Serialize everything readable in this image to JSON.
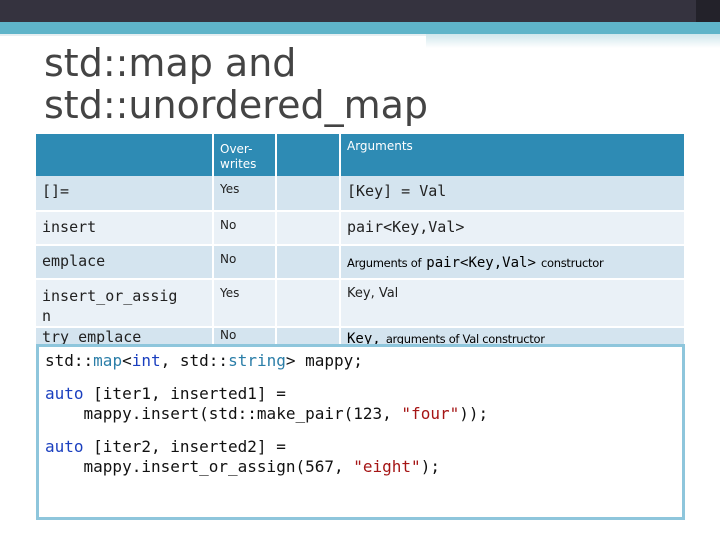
{
  "title": "std::map and std::unordered_map",
  "title_line1": "std::map and",
  "title_line2": "std::unordered_map",
  "table": {
    "headers": {
      "overwrites": "Over-\nwrites",
      "arguments": "Arguments"
    },
    "rows": [
      {
        "method": "[]=",
        "overwrites": "Yes",
        "args": "[Key] = Val"
      },
      {
        "method": "insert",
        "overwrites": "No",
        "args": "pair<Key,Val>"
      },
      {
        "method": "emplace",
        "overwrites": "No",
        "args_prefix": "Arguments of",
        "args_code": "pair<Key,Val>",
        "args_suffix": "constructor"
      },
      {
        "method": "insert_or_assign",
        "method_line1": "insert_or_assig",
        "method_line2": "n",
        "overwrites": "Yes",
        "args": "Key, Val"
      },
      {
        "method": "try_emplace",
        "overwrites": "No",
        "args_code": "Key,",
        "args_suffix": "arguments of Val constructor"
      }
    ]
  },
  "code": {
    "line1": {
      "ns1": "std::",
      "map": "map",
      "lt": "<",
      "int": "int",
      "mid": ", std::",
      "string": "string",
      "rest": "> mappy;"
    },
    "line2": {
      "auto": "auto",
      "rest": " [iter1, inserted1] ="
    },
    "line3": {
      "pre": "    mappy.insert(std::make_pair(123, ",
      "str": "\"four\"",
      "post": "));"
    },
    "line4": {
      "auto": "auto",
      "rest": " [iter2, inserted2] ="
    },
    "line5": {
      "pre": "    mappy.insert_or_assign(567, ",
      "str": "\"eight\"",
      "post": ");"
    }
  },
  "colors": {
    "header": "#2e8bb4",
    "row_dark": "#d4e4ef",
    "row_light": "#eaf1f7",
    "code_border": "#8ec6dc",
    "keyword": "#1a3fbf",
    "string": "#a51515"
  }
}
